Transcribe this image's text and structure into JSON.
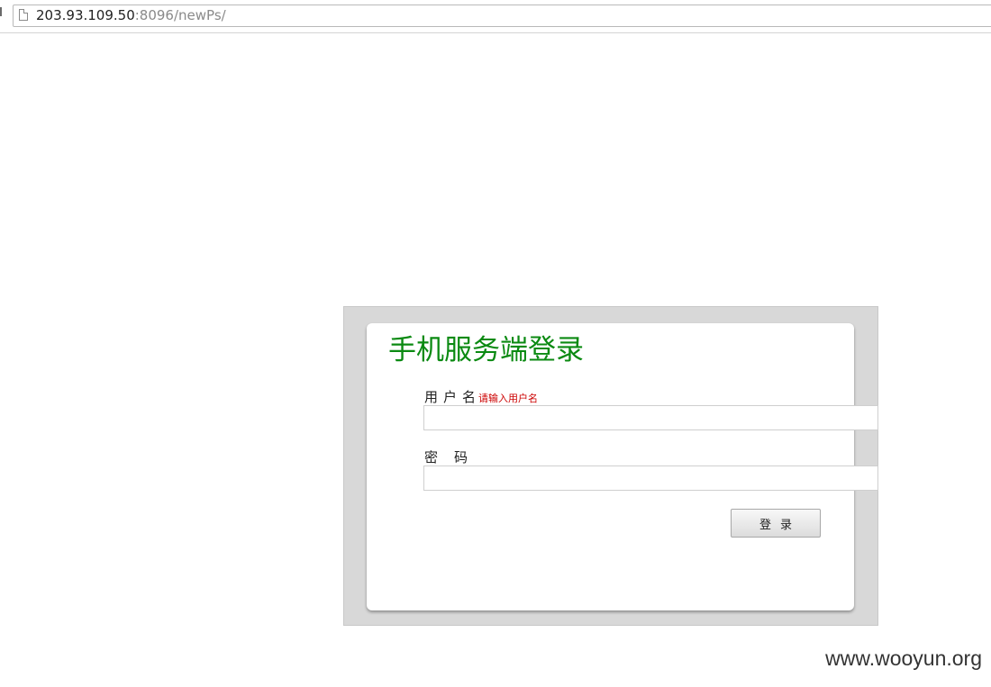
{
  "browser": {
    "url_host": "203.93.109.50",
    "url_rest": ":8096/newPs/",
    "page_icon": "document-icon"
  },
  "login": {
    "title": "手机服务端登录",
    "username_label": "用户名",
    "username_hint": "请输入用户名",
    "username_value": "",
    "password_label": "密码",
    "password_value": "",
    "submit_label": "登录"
  },
  "watermark": "www.wooyun.org",
  "colors": {
    "title": "#0b8a12",
    "hint": "#cc0000",
    "panel_border": "#d8d8d8"
  }
}
